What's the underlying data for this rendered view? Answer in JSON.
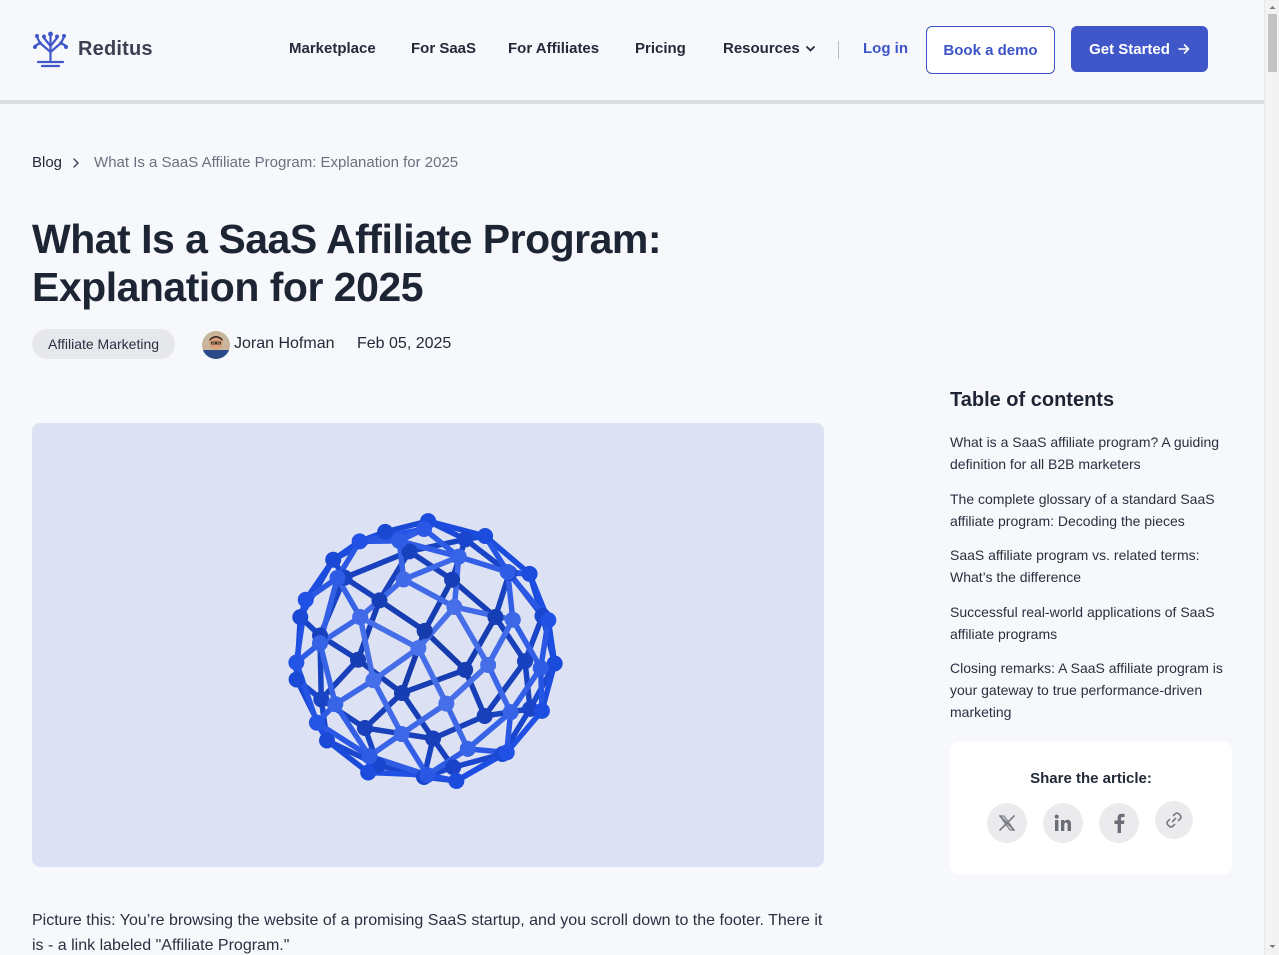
{
  "brand": {
    "name": "Reditus",
    "accent": "#4057c9"
  },
  "nav": {
    "items": [
      "Marketplace",
      "For SaaS",
      "For Affiliates",
      "Pricing"
    ],
    "resources": "Resources",
    "login": "Log in",
    "demo": "Book a demo",
    "start": "Get Started"
  },
  "breadcrumb": {
    "root": "Blog",
    "current": "What Is a SaaS Affiliate Program: Explanation for 2025"
  },
  "article": {
    "title": "What Is a SaaS Affiliate Program: Explanation for 2025",
    "tag": "Affiliate Marketing",
    "author": "Joran Hofman",
    "date": "Feb 05, 2025",
    "intro": "Picture this: You’re browsing the website of a promising SaaS startup, and you scroll down to the footer. There it is - a link labeled \"Affiliate Program.\""
  },
  "toc": {
    "title": "Table of contents",
    "items": [
      "What is a SaaS affiliate program? A guiding definition for all B2B marketers",
      "The complete glossary of a standard SaaS affiliate program: Decoding the pieces",
      "SaaS affiliate program vs. related terms: What’s the difference",
      "Successful real-world applications of SaaS affiliate programs",
      "Closing remarks: A SaaS affiliate program is your gateway to true performance-driven marketing"
    ]
  },
  "share": {
    "title": "Share the article:",
    "icons": [
      "x-icon",
      "linkedin-icon",
      "facebook-icon",
      "link-icon"
    ]
  }
}
